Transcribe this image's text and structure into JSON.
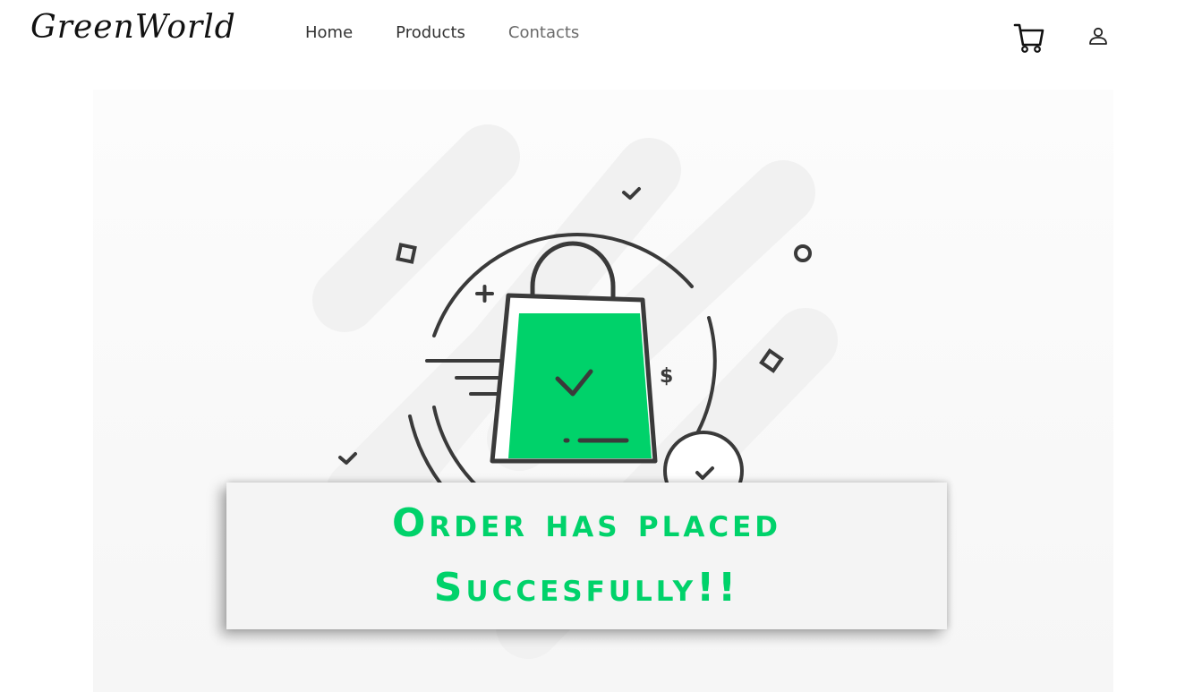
{
  "header": {
    "logo": "GreenWorld",
    "nav": [
      {
        "label": "Home"
      },
      {
        "label": "Products"
      },
      {
        "label": "Contacts"
      }
    ],
    "cart_icon": "cart-icon",
    "user_icon": "user-icon"
  },
  "illustration": {
    "icon": "shopping-bag-check-icon",
    "currency_symbol": "$"
  },
  "banner": {
    "line1": "Order has placed",
    "line2": "Succesfully!!"
  },
  "colors": {
    "accent": "#00d26a",
    "icon_stroke": "#3a3a3a",
    "deco_gray": "#f0f0f0"
  }
}
